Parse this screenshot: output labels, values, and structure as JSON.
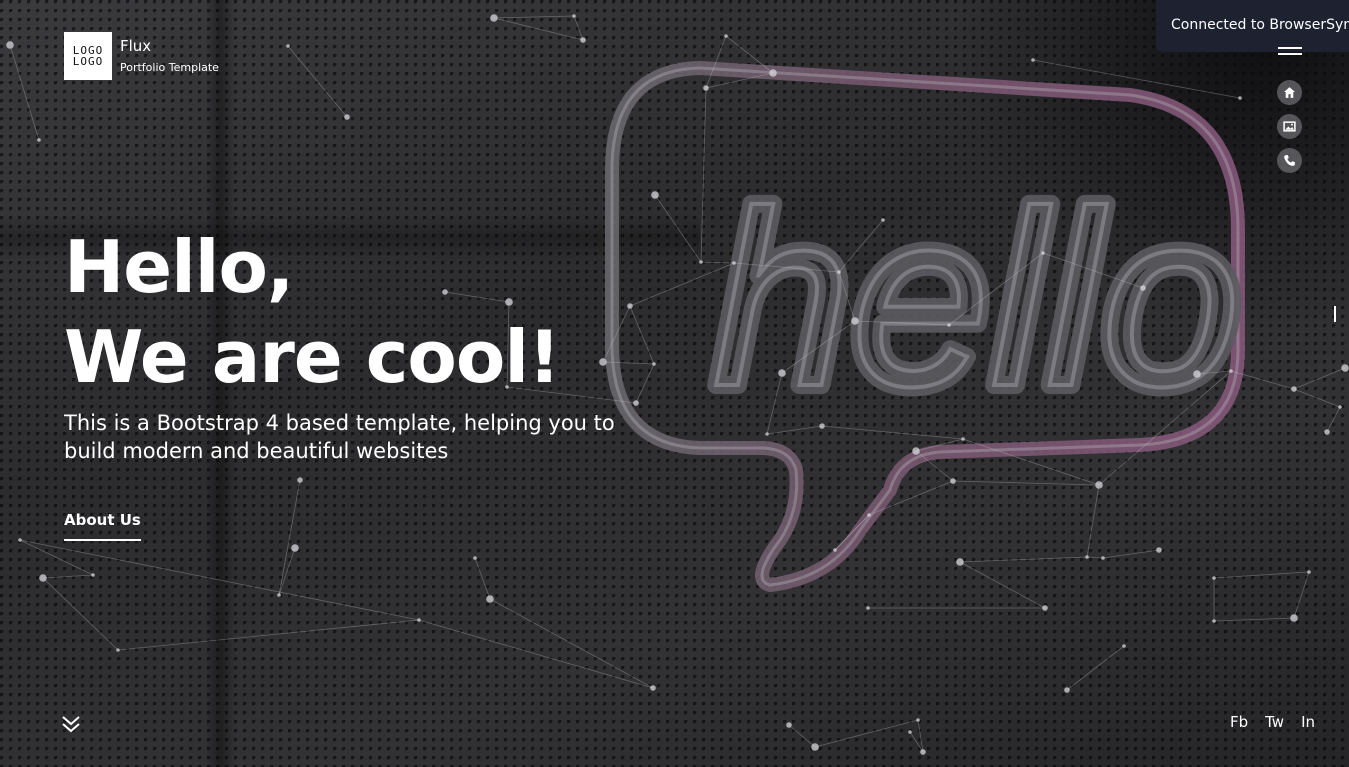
{
  "brand": {
    "logo_line1": "LOGO",
    "logo_line2": "LOGO",
    "name": "Flux",
    "tagline": "Portfolio Template"
  },
  "hero": {
    "title_line1": "Hello,",
    "title_line2": "We are cool!",
    "subtitle": "This is a Bootstrap 4 based template, helping you to build modern and beautiful websites",
    "cta_label": "About Us",
    "background_sign_text": "hello"
  },
  "notification": {
    "text": "Connected to BrowserSync"
  },
  "side_nav": {
    "items": [
      {
        "icon": "home-icon"
      },
      {
        "icon": "image-icon"
      },
      {
        "icon": "phone-icon"
      }
    ]
  },
  "social": {
    "links": [
      "Fb",
      "Tw",
      "In"
    ]
  },
  "colors": {
    "text": "#ffffff",
    "notification_bg": "#1d2130",
    "neon_outline": "#8a5a7e",
    "background": "#2c2c2e"
  }
}
